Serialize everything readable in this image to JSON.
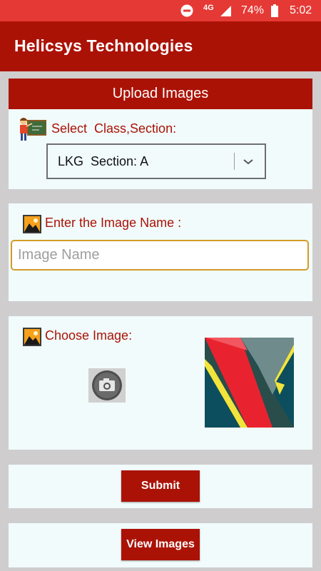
{
  "status_bar": {
    "network": "4G",
    "battery": "74%",
    "time": "5:02"
  },
  "app": {
    "title": "Helicsys Technologies"
  },
  "upload_section": {
    "header": "Upload Images",
    "select_label": "Select  Class,Section:",
    "selected_value": "LKG  Section: A"
  },
  "image_name_section": {
    "label": "Enter the Image Name :",
    "placeholder": "Image Name",
    "value": ""
  },
  "choose_image_section": {
    "label": "Choose Image:"
  },
  "buttons": {
    "submit": "Submit",
    "view_images": "View Images"
  },
  "colors": {
    "status_bar": "#e53935",
    "app_bar": "#ab1206",
    "accent": "#ab1206",
    "card_background": "#f1fbfb",
    "page_background": "#cfcdcd",
    "input_focus_border": "#d19c28"
  },
  "icons": {
    "dnd": "do-not-disturb-icon",
    "signal": "cell-signal-icon",
    "battery": "battery-icon",
    "teacher": "teacher-icon",
    "image": "image-icon",
    "camera": "camera-icon",
    "dropdown": "chevron-down-icon"
  }
}
